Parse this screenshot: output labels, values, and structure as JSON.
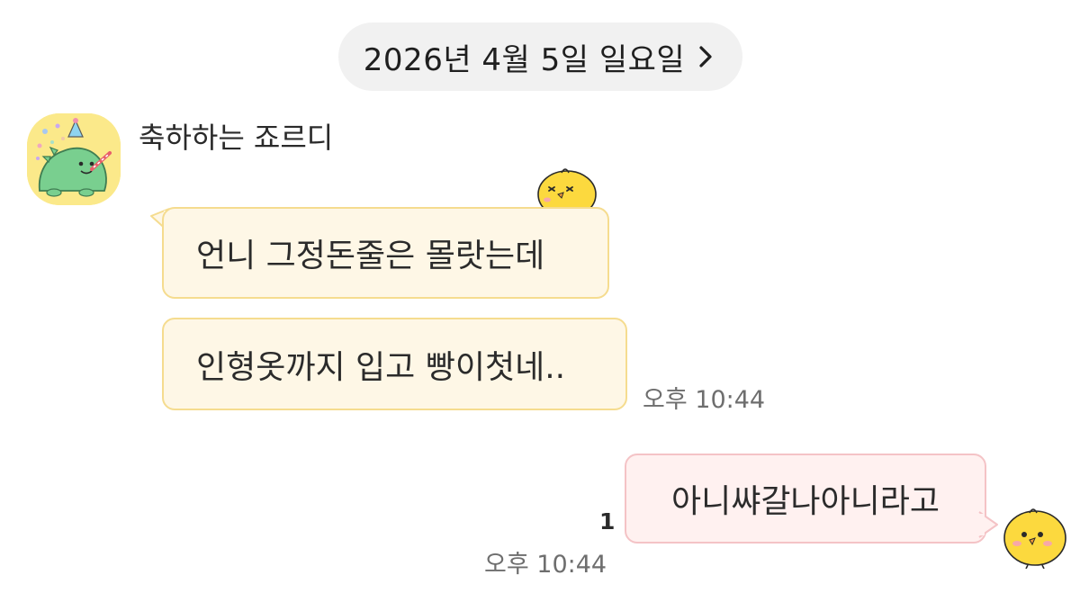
{
  "header": {
    "date_label": "2026년 4월 5일 일요일",
    "chevron_icon": "chevron-right-icon"
  },
  "conversation": {
    "sender": {
      "name": "축하하는 죠르디",
      "avatar_icon": "jordy-dinosaur-avatar"
    },
    "incoming": [
      {
        "text": "언니 그정돈줄은 몰랏는데"
      },
      {
        "text": "인형옷까지 입고 빵이첫네.."
      }
    ],
    "incoming_time": "오후 10:44",
    "outgoing": {
      "text": "아니쌰갈나아니라고",
      "unread_count": "1",
      "time": "오후 10:44"
    }
  },
  "colors": {
    "date_pill_bg": "#f1f1f1",
    "incoming_bubble_bg": "#fef7e6",
    "incoming_bubble_border": "#f5dc8f",
    "outgoing_bubble_bg": "#fff1f0",
    "outgoing_bubble_border": "#f4c3c6",
    "avatar_bg": "#fbe98a"
  }
}
